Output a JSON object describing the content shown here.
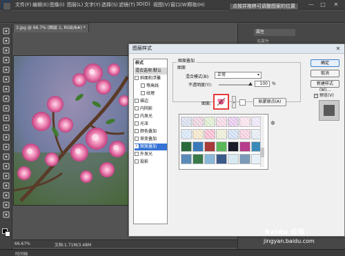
{
  "app": {
    "logo": "Ps",
    "menu": [
      "文件(F)",
      "编辑(E)",
      "图像(I)",
      "图层(L)",
      "文字(Y)",
      "选择(S)",
      "滤镜(T)",
      "3D(D)",
      "视图(V)",
      "窗口(W)",
      "帮助(H)"
    ],
    "window_buttons": [
      "—",
      "□",
      "✕"
    ]
  },
  "options_bar": {
    "auto_text": "点按并拖移可调整图案的位置"
  },
  "document": {
    "tab_label": "3.jpg @ 66.7% (图层 1, RGB/8#) *"
  },
  "status": {
    "zoom": "66.67%",
    "doc_info": "文档:1.71M/3.48M",
    "timeline_label": "时间轴"
  },
  "right_panel": {
    "tab": "属性",
    "no_style": "无属性"
  },
  "dialog": {
    "title": "图层样式",
    "close": "✕",
    "styles_header": "样式",
    "blend_default": "混合选项:默认",
    "style_items": [
      {
        "label": "斜面和浮雕",
        "checked": false,
        "indent": false,
        "selected": false
      },
      {
        "label": "等高线",
        "checked": false,
        "indent": true,
        "selected": false
      },
      {
        "label": "纹理",
        "checked": false,
        "indent": true,
        "selected": false
      },
      {
        "label": "描边",
        "checked": false,
        "indent": false,
        "selected": false
      },
      {
        "label": "内阴影",
        "checked": false,
        "indent": false,
        "selected": false
      },
      {
        "label": "内发光",
        "checked": false,
        "indent": false,
        "selected": false
      },
      {
        "label": "光泽",
        "checked": false,
        "indent": false,
        "selected": false
      },
      {
        "label": "颜色叠加",
        "checked": false,
        "indent": false,
        "selected": false
      },
      {
        "label": "渐变叠加",
        "checked": false,
        "indent": false,
        "selected": false
      },
      {
        "label": "图案叠加",
        "checked": true,
        "indent": false,
        "selected": true
      },
      {
        "label": "外发光",
        "checked": false,
        "indent": false,
        "selected": false
      },
      {
        "label": "投影",
        "checked": false,
        "indent": false,
        "selected": false
      }
    ],
    "group_title": "图案叠加",
    "sub_title": "图案",
    "blend_mode_label": "混合模式(B):",
    "blend_mode_value": "正常",
    "opacity_label": "不透明度(Y):",
    "opacity_value": "100",
    "opacity_unit": "%",
    "opacity_fraction": 1.0,
    "pattern_label": "图案:",
    "snap_origin": "贴紧原点(A)",
    "picker_gear": "✲",
    "buttons": {
      "ok": "确定",
      "cancel": "取消",
      "new_style": "新建样式(W)...",
      "preview": "预览(V)"
    },
    "accent": "#e53a3a",
    "selection": "#3574d4"
  },
  "watermark": {
    "brand": "Baidu 经验",
    "url": "jingyan.baidu.com"
  }
}
